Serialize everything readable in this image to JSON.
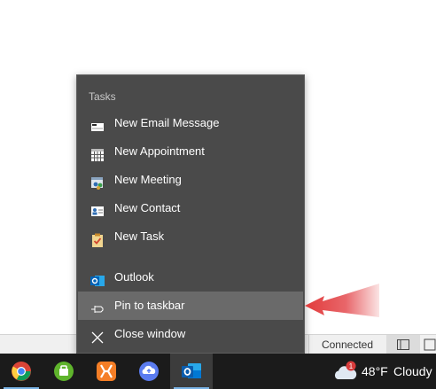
{
  "jumplist": {
    "header": "Tasks",
    "tasks": [
      {
        "label": "New Email Message",
        "icon": "email-icon"
      },
      {
        "label": "New Appointment",
        "icon": "calendar-icon"
      },
      {
        "label": "New Meeting",
        "icon": "meeting-icon"
      },
      {
        "label": "New Contact",
        "icon": "contact-card-icon"
      },
      {
        "label": "New Task",
        "icon": "task-clipboard-icon"
      }
    ],
    "app": {
      "label": "Outlook",
      "icon": "outlook-icon"
    },
    "pin": {
      "label": "Pin to taskbar",
      "icon": "pin-icon"
    },
    "close": {
      "label": "Close window",
      "icon": "close-icon"
    }
  },
  "statusbar": {
    "connection": "Connected"
  },
  "taskbar": {
    "apps": [
      {
        "name": "chrome-icon"
      },
      {
        "name": "evernote-icon"
      },
      {
        "name": "xampp-icon"
      },
      {
        "name": "cloud-upload-icon"
      },
      {
        "name": "outlook-icon"
      }
    ],
    "weather": {
      "temp": "48°F",
      "condition": "Cloudy",
      "badge": "1"
    }
  },
  "colors": {
    "menu_bg": "#4a4a4a",
    "hover": "#6a6a6a",
    "taskbar": "#1b1b1b",
    "annotation": "#e23b3b"
  }
}
